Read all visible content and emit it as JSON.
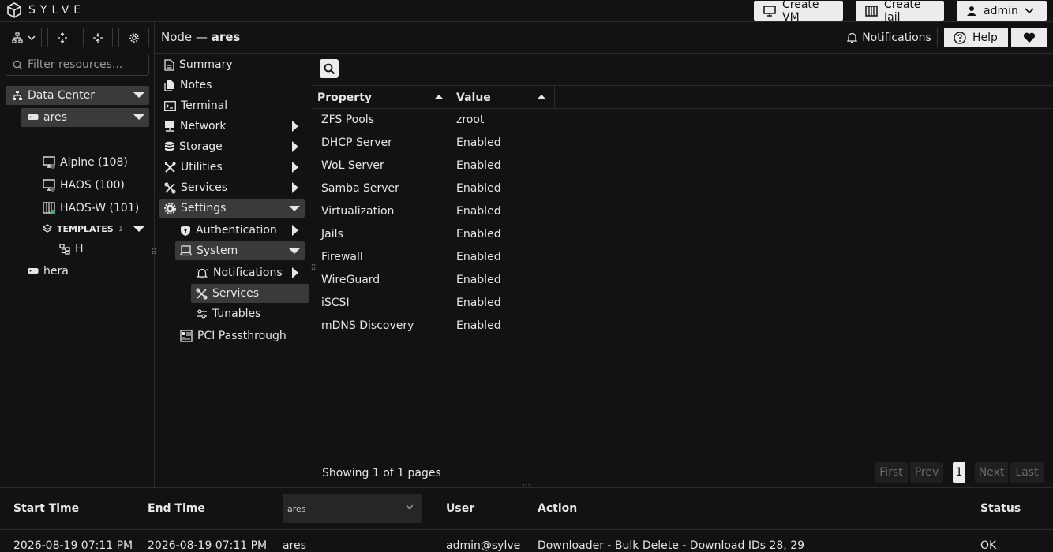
{
  "brand": {
    "name": "SYLVE"
  },
  "top_buttons": {
    "create_vm": "Create VM",
    "create_jail": "Create Jail",
    "user": "admin"
  },
  "header": {
    "prefix": "Node —",
    "node": "ares",
    "notifications": "Notifications",
    "help": "Help"
  },
  "search": {
    "placeholder": "Filter resources..."
  },
  "tree": {
    "datacenter": "Data Center",
    "nodes": [
      {
        "label": "ares"
      },
      {
        "label": "hera"
      }
    ],
    "guests": [
      {
        "label": "Alpine (108)",
        "status": "stopped"
      },
      {
        "label": "HAOS (100)",
        "status": "stopped"
      },
      {
        "label": "HAOS-W (101)",
        "status": "running"
      }
    ],
    "templates": {
      "label": "TEMPLATES",
      "count": "1",
      "items": [
        {
          "label": "H"
        }
      ]
    }
  },
  "menu": {
    "summary": "Summary",
    "notes": "Notes",
    "terminal": "Terminal",
    "network": "Network",
    "storage": "Storage",
    "utilities": "Utilities",
    "services": "Services",
    "settings": "Settings",
    "authentication": "Authentication",
    "system": "System",
    "notifications": "Notifications",
    "sys_services": "Services",
    "tunables": "Tunables",
    "pci": "PCI Passthrough"
  },
  "table": {
    "headers": {
      "property": "Property",
      "value": "Value"
    },
    "rows": [
      {
        "property": "ZFS Pools",
        "value": "zroot"
      },
      {
        "property": "DHCP Server",
        "value": "Enabled"
      },
      {
        "property": "WoL Server",
        "value": "Enabled"
      },
      {
        "property": "Samba Server",
        "value": "Enabled"
      },
      {
        "property": "Virtualization",
        "value": "Enabled"
      },
      {
        "property": "Jails",
        "value": "Enabled"
      },
      {
        "property": "Firewall",
        "value": "Enabled"
      },
      {
        "property": "WireGuard",
        "value": "Enabled"
      },
      {
        "property": "iSCSI",
        "value": "Enabled"
      },
      {
        "property": "mDNS Discovery",
        "value": "Enabled"
      }
    ]
  },
  "pager": {
    "status": "Showing 1 of 1 pages",
    "first": "First",
    "prev": "Prev",
    "page": "1",
    "next": "Next",
    "last": "Last"
  },
  "tasks": {
    "headers": {
      "start": "Start Time",
      "end": "End Time",
      "node_select": "ares",
      "user": "User",
      "action": "Action",
      "status": "Status"
    },
    "row": {
      "start": "2026-08-19 07:11 PM",
      "end": "2026-08-19 07:11 PM",
      "node": "ares",
      "user": "admin@sylve",
      "action": "Downloader - Bulk Delete - Download IDs 28, 29",
      "status": "OK"
    }
  },
  "colors": {
    "accent": "#ececec",
    "running": "#22c55e",
    "stopped": "#6b6b6b",
    "selected": "#3a3a3a"
  }
}
